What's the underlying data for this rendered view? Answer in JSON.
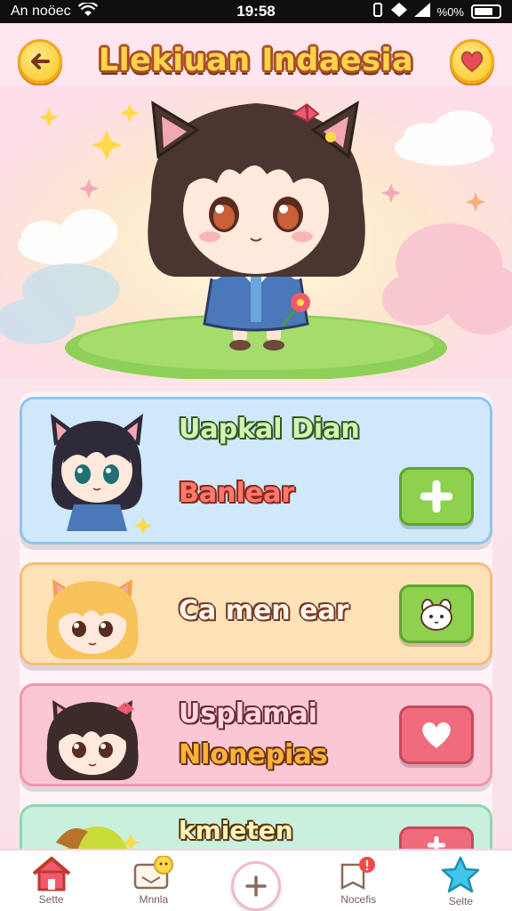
{
  "status_bar": {
    "carrier": "An noöec",
    "time": "19:58",
    "battery_text": "%0%"
  },
  "header": {
    "title": "Llekiuan Indaesia",
    "back_icon": "arrow-left-icon",
    "favorite_icon": "heart-icon"
  },
  "cards": [
    {
      "title": "Uapkal Dian",
      "subtitle": "Banlear",
      "action_icon": "plus-icon",
      "bg": "#cfe9fb",
      "border": "#8fc6ea",
      "action_color": "#8ed14f"
    },
    {
      "title": "Ca men ear",
      "subtitle": "",
      "action_icon": "bunny-face-icon",
      "bg": "#fde2b8",
      "border": "#f2bd78",
      "action_color": "#8ed14f"
    },
    {
      "title": "Usplamai",
      "subtitle": "Nlonepias",
      "action_icon": "heart-icon",
      "bg": "#fbc7d4",
      "border": "#ef98ad",
      "action_color": "#f06b7b"
    },
    {
      "title": "kmieten",
      "subtitle": "",
      "action_icon": "plus-icon",
      "bg": "#c9f0dc",
      "border": "#8fd7b4",
      "action_color": "#f06b7b"
    }
  ],
  "nav": [
    {
      "label": "Sette",
      "icon": "home-icon"
    },
    {
      "label": "Mnnla",
      "icon": "chat-icon"
    },
    {
      "label": "",
      "icon": "plus-icon"
    },
    {
      "label": "Nocefis",
      "icon": "notification-icon"
    },
    {
      "label": "Selte",
      "icon": "star-icon"
    }
  ]
}
